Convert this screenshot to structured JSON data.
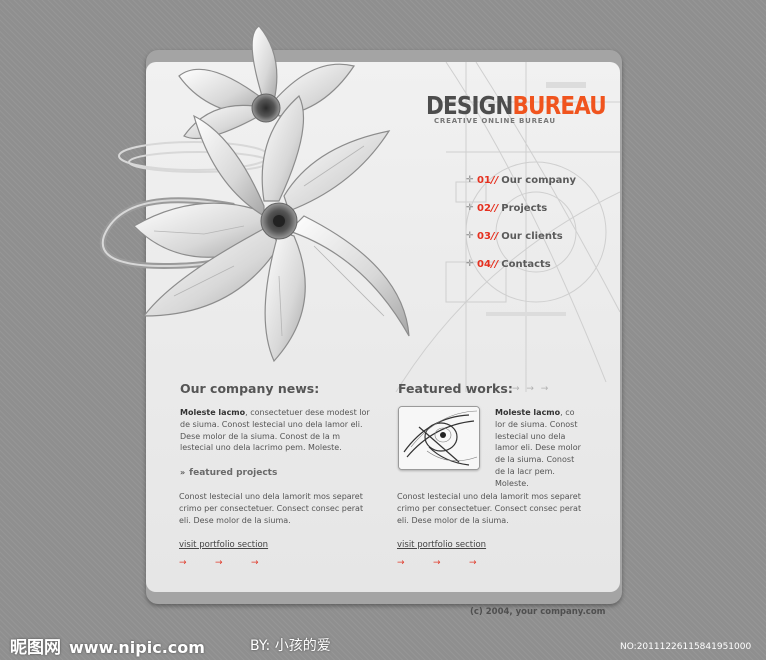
{
  "brand": {
    "name_part1": "DESIGN",
    "name_part2": "BUREAU",
    "tagline": "CREATIVE ONLINE BUREAU",
    "accent_color": "#f0541e"
  },
  "nav": {
    "items": [
      {
        "num": "01",
        "sep": "//",
        "label": "Our company"
      },
      {
        "num": "02",
        "sep": "//",
        "label": "Projects"
      },
      {
        "num": "03",
        "sep": "//",
        "label": "Our clients"
      },
      {
        "num": "04",
        "sep": "//",
        "label": "Contacts"
      }
    ],
    "number_color": "#e5301f"
  },
  "news": {
    "title": "Our company news:",
    "lead_bold": "Moleste lacmo",
    "lead_text": ", consectetuer dese modest lor de siuma. Conost lestecial uno dela lamor eli. Dese molor de la siuma. Conost de la m lestecial uno dela lacrimo pem. Moleste.",
    "featured_label": "featured projects",
    "body2": "Conost lestecial uno dela lamorit mos separet crimo per consectetuer. Consect consec perat eli. Dese molor de la siuma.",
    "link": "visit portfolio section",
    "arrows": [
      "→",
      "→",
      "→"
    ]
  },
  "works": {
    "title": "Featured works:",
    "title_arrows": "→ → →",
    "lead_bold": "Moleste lacmo",
    "lead_text": ", co lor de siuma. Conost lestecial uno dela lamor eli. Dese molor de la siuma. Conost de la lacr pem. Moleste.",
    "body2": "Conost lestecial uno dela lamorit mos separet crimo per consectetuer. Consect consec perat eli. Dese molor de la siuma.",
    "link": "visit portfolio section",
    "arrows": [
      "→",
      "→",
      "→"
    ]
  },
  "footer": {
    "copyright": "(c) 2004, your company.com"
  },
  "watermark": {
    "left_cn": "昵图网",
    "left_site": "www.nipic.com",
    "middle": "BY: 小孩的爱",
    "right": "NO:20111226115841951000"
  }
}
